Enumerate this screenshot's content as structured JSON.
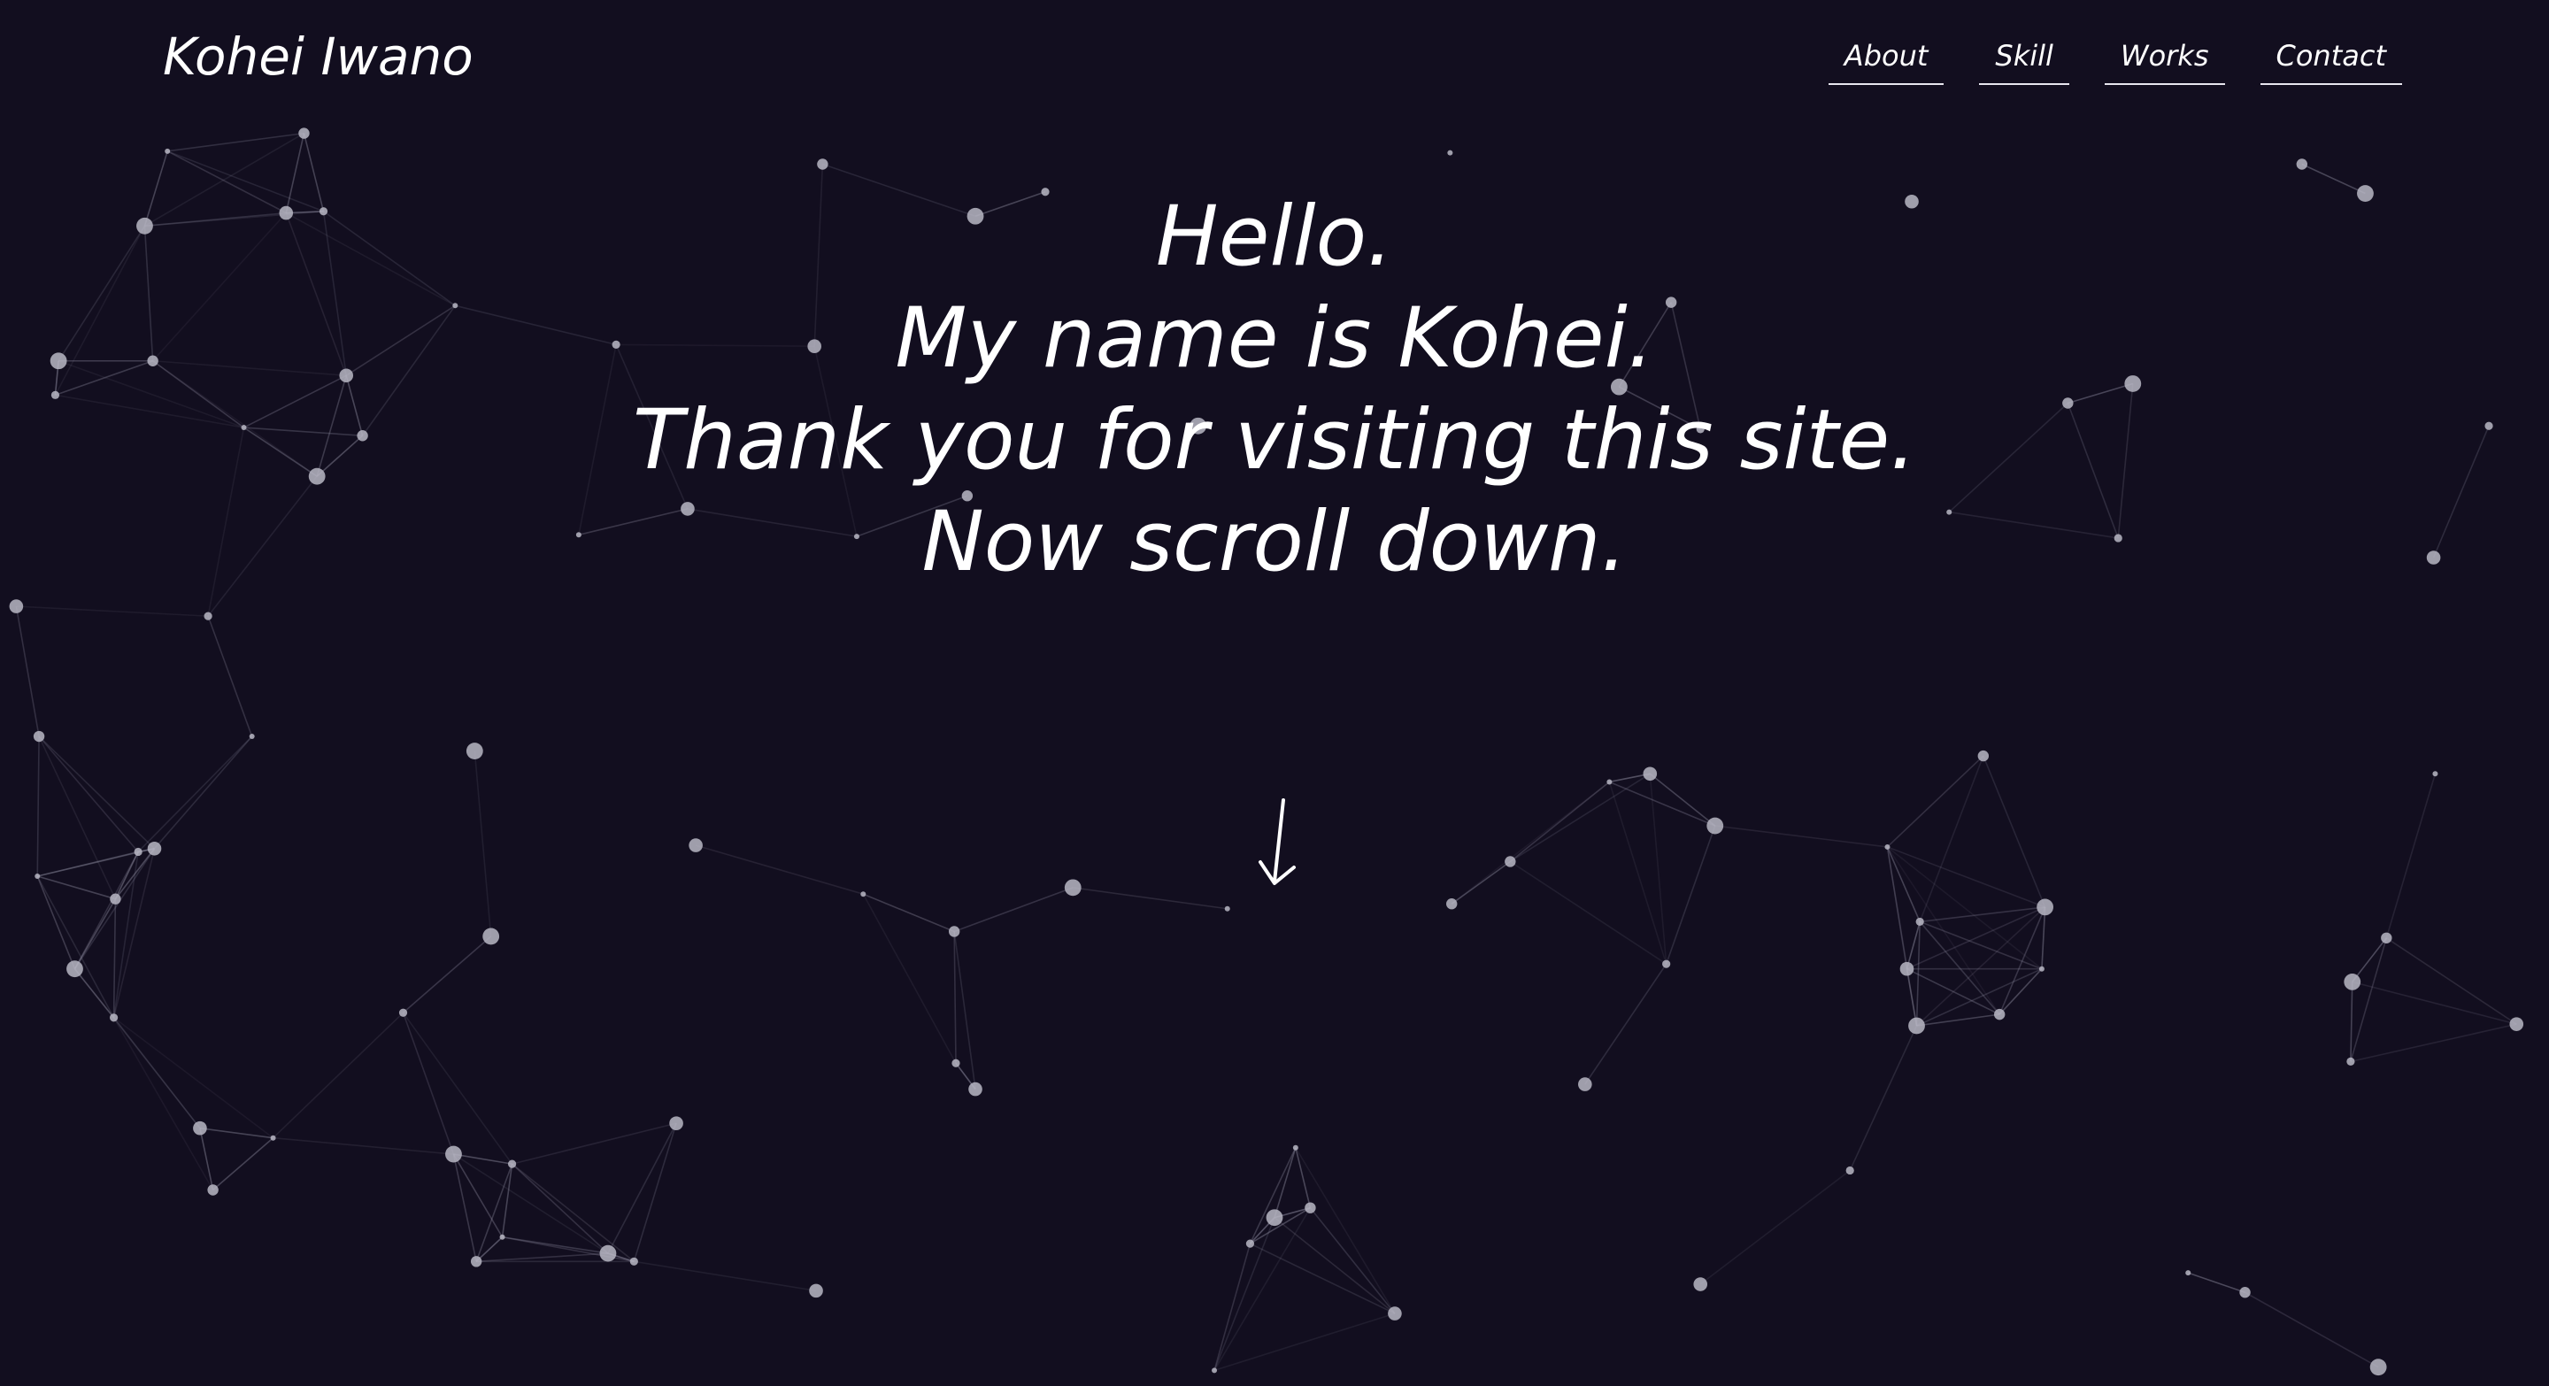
{
  "header": {
    "logo": "Kohei Iwano",
    "nav": [
      {
        "label": "About"
      },
      {
        "label": "Skill"
      },
      {
        "label": "Works"
      },
      {
        "label": "Contact"
      }
    ]
  },
  "hero": {
    "lines": [
      "Hello.",
      "My name is Kohei.",
      "Thank you for visiting this site.",
      "Now scroll down."
    ]
  },
  "scroll_indicator": {
    "icon": "arrow-down-icon"
  },
  "colors": {
    "background": "#120e1f",
    "text": "#ffffff",
    "network_line": "#8c8a9e",
    "network_node": "#b9b7c4"
  }
}
